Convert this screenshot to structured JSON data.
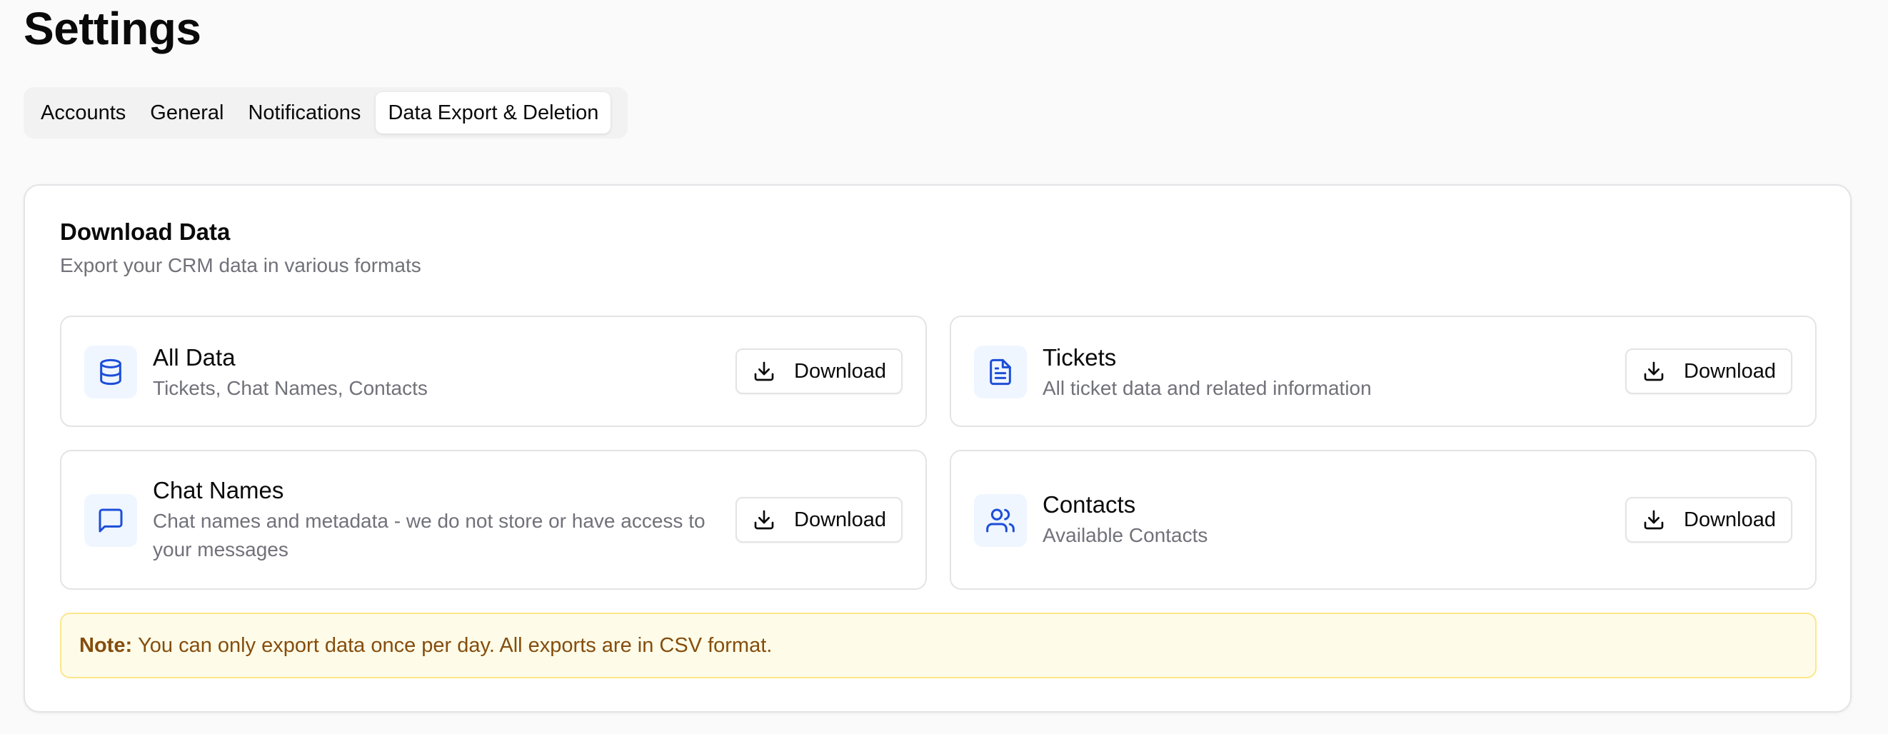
{
  "page": {
    "title": "Settings"
  },
  "tabs": [
    {
      "label": "Accounts",
      "active": false
    },
    {
      "label": "General",
      "active": false
    },
    {
      "label": "Notifications",
      "active": false
    },
    {
      "label": "Data Export & Deletion",
      "active": true
    }
  ],
  "download": {
    "title": "Download Data",
    "description": "Export your CRM data in various formats",
    "items": [
      {
        "name": "All Data",
        "description": "Tickets, Chat Names, Contacts",
        "icon": "database-icon",
        "button_label": "Download"
      },
      {
        "name": "Tickets",
        "description": "All ticket data and related information",
        "icon": "file-text-icon",
        "button_label": "Download"
      },
      {
        "name": "Chat Names",
        "description": "Chat names and metadata - we do not store or have access to your messages",
        "icon": "message-square-icon",
        "button_label": "Download"
      },
      {
        "name": "Contacts",
        "description": "Available Contacts",
        "icon": "users-icon",
        "button_label": "Download"
      }
    ]
  },
  "note": {
    "label": "Note:",
    "text": "You can only export data once per day. All exports are in CSV format."
  },
  "colors": {
    "accent_icon": "#1d4ed8",
    "icon_bg": "#eff6ff",
    "note_bg": "#fefce8",
    "note_text": "#854d0e"
  }
}
